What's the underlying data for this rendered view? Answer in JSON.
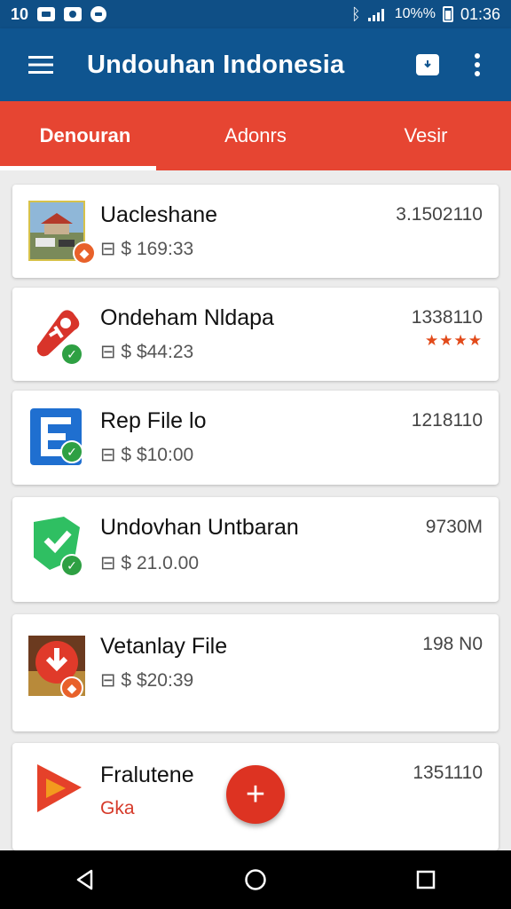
{
  "status_bar": {
    "time_left": "10",
    "battery_pct": "10%%",
    "time_right": "01:36",
    "icons": [
      "image-icon",
      "photo-icon",
      "message-icon",
      "bluetooth-icon",
      "signal-icon",
      "battery-icon"
    ]
  },
  "app_bar": {
    "title": "Undouhan Indonesia",
    "icons": [
      "menu-icon",
      "download-icon",
      "more-vert-icon"
    ]
  },
  "tabs": [
    {
      "label": "Denouran",
      "active": true
    },
    {
      "label": "Adonrs",
      "active": false
    },
    {
      "label": "Vesir",
      "active": false
    }
  ],
  "items": [
    {
      "name": "Uacleshane",
      "meta": "⊟ $ 169:33",
      "right": "3.1502110",
      "badge": "warn",
      "thumb": "photo-thumbnail"
    },
    {
      "name": "Ondeham Nldapa",
      "meta": "⊟ $ $44:23",
      "right": "1338110",
      "rating": "★★★★",
      "badge": "ok",
      "thumb": "red-tag-icon"
    },
    {
      "name": "Rep File lo",
      "meta": "⊟ $ $10:00",
      "right": "1218110",
      "badge": "ok",
      "thumb": "blue-document-icon"
    },
    {
      "name": "Undovhan Untbaran",
      "meta": "⊟ $ 21.0.00",
      "right": "9730M",
      "badge": "ok",
      "thumb": "green-shield-icon"
    },
    {
      "name": "Vetanlay File",
      "meta": "⊟ $ $20:39",
      "right": "198 N0",
      "badge": "warn",
      "thumb": "red-download-thumbnail"
    },
    {
      "name": "Fralutene",
      "meta": "Gka",
      "right": "1351110",
      "badge": "none",
      "thumb": "play-icon"
    }
  ],
  "fab": {
    "label": "+"
  },
  "nav_bar": {
    "icons": [
      "back-icon",
      "home-icon",
      "recents-icon"
    ]
  },
  "colors": {
    "app_bar": "#0f5590",
    "tabs": "#e64532",
    "fab": "#dd3322",
    "badge_ok": "#2ea043",
    "badge_warn": "#e8612a"
  }
}
